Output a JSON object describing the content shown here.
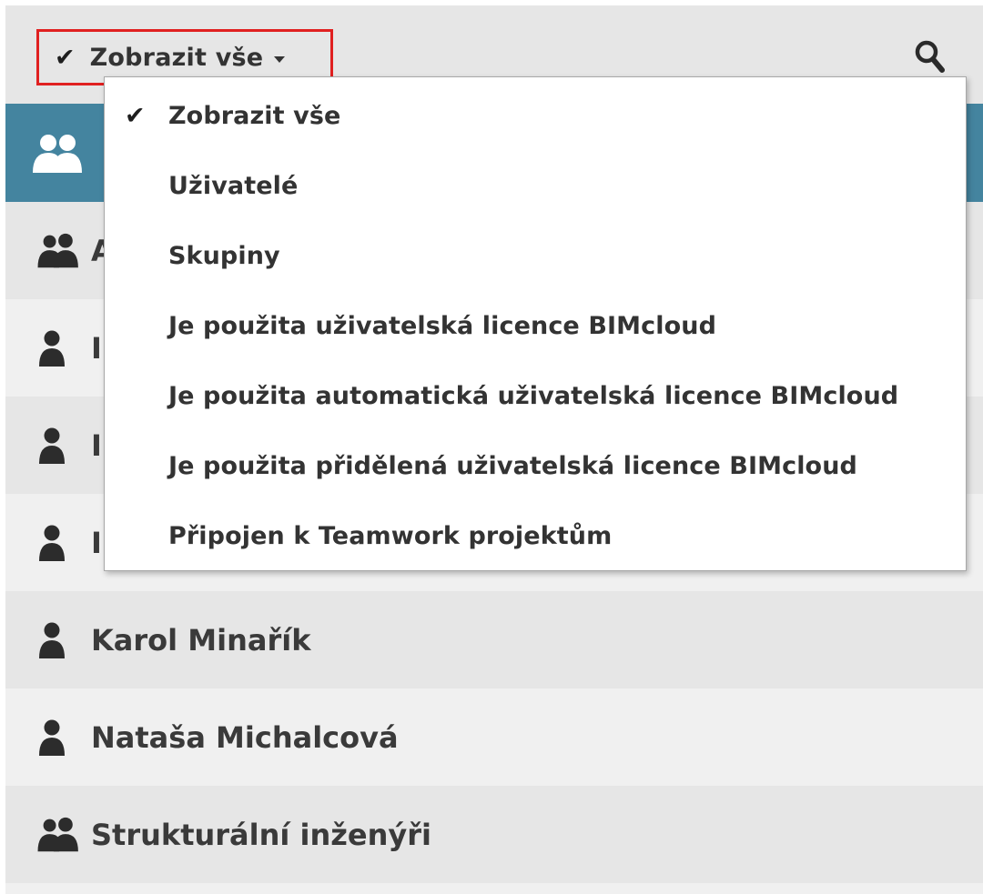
{
  "toolbar": {
    "filter_label": "Zobrazit vše",
    "filter_check": "✔",
    "search_icon": "search-icon"
  },
  "list": {
    "rows": [
      {
        "type": "group",
        "name": "A"
      },
      {
        "type": "user",
        "name": "I"
      },
      {
        "type": "user",
        "name": "I"
      },
      {
        "type": "user",
        "name": "I"
      },
      {
        "type": "user",
        "name": "Karol Minařík"
      },
      {
        "type": "user",
        "name": "Nataša Michalcová"
      },
      {
        "type": "group",
        "name": "Strukturální inženýři"
      }
    ]
  },
  "dropdown": {
    "selected": "Zobrazit vše",
    "check": "✔",
    "items": [
      "Zobrazit vše",
      "Uživatelé",
      "Skupiny",
      "Je použita uživatelská licence BIMcloud",
      "Je použita automatická uživatelská licence BIMcloud",
      "Je použita přidělená uživatelská licence BIMcloud",
      "Připojen k Teamwork projektům"
    ]
  },
  "colors": {
    "toolbar_bg": "#e6e6e6",
    "header_bg": "#44849f",
    "highlight_border": "#e02020",
    "row_dark": "#e6e6e6",
    "row_light": "#f0f0f0"
  }
}
